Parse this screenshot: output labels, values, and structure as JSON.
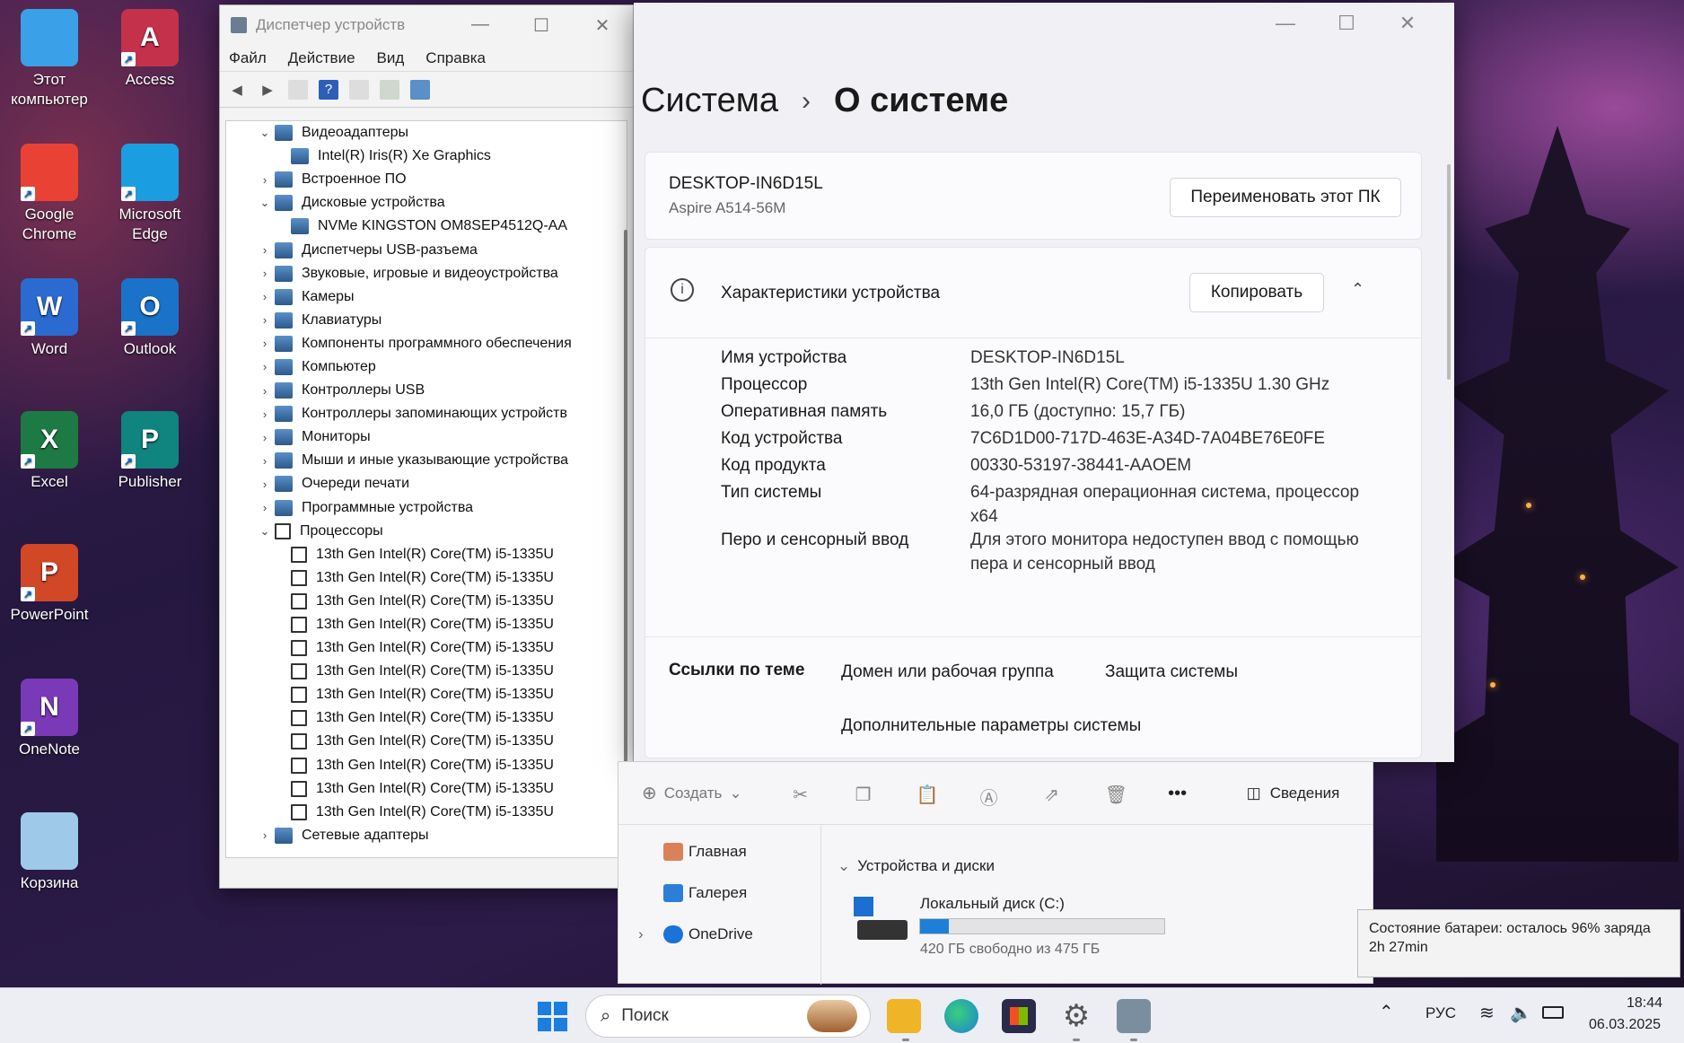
{
  "desktop": {
    "icons": [
      {
        "label": "Этот компьютер",
        "icon": "monitor-icon",
        "color": "#3aa0e8"
      },
      {
        "label": "Access",
        "icon": "access-icon",
        "color": "#c4314b",
        "letter": "A"
      },
      {
        "label": "Google Chrome",
        "icon": "chrome-icon",
        "color": "#e94235"
      },
      {
        "label": "Microsoft Edge",
        "icon": "edge-icon",
        "color": "#1b9de2"
      },
      {
        "label": "Word",
        "icon": "word-icon",
        "color": "#2b6bd1",
        "letter": "W"
      },
      {
        "label": "Outlook",
        "icon": "outlook-icon",
        "color": "#1a73c8",
        "letter": "O"
      },
      {
        "label": "Excel",
        "icon": "excel-icon",
        "color": "#1d7a45",
        "letter": "X"
      },
      {
        "label": "Publisher",
        "icon": "publisher-icon",
        "color": "#10847e",
        "letter": "P"
      },
      {
        "label": "PowerPoint",
        "icon": "powerpoint-icon",
        "color": "#d24726",
        "letter": "P"
      },
      {
        "label": "OneNote",
        "icon": "onenote-icon",
        "color": "#7a3ab8",
        "letter": "N"
      },
      {
        "label": "Корзина",
        "icon": "recycle-bin-icon",
        "color": "#9fc9e8"
      }
    ]
  },
  "devmgr": {
    "title": "Диспетчер устройств",
    "menu": [
      "Файл",
      "Действие",
      "Вид",
      "Справка"
    ],
    "tree": [
      {
        "label": "Видеоадаптеры",
        "level": 0,
        "exp": "v",
        "type": "cat"
      },
      {
        "label": "Intel(R) Iris(R) Xe Graphics",
        "level": 1,
        "exp": "",
        "type": "cat"
      },
      {
        "label": "Встроенное ПО",
        "level": 0,
        "exp": ">",
        "type": "cat"
      },
      {
        "label": "Дисковые устройства",
        "level": 0,
        "exp": "v",
        "type": "cat"
      },
      {
        "label": "NVMe KINGSTON OM8SEP4512Q-AA",
        "level": 1,
        "exp": "",
        "type": "cat"
      },
      {
        "label": "Диспетчеры USB-разъема",
        "level": 0,
        "exp": ">",
        "type": "cat"
      },
      {
        "label": "Звуковые, игровые и видеоустройства",
        "level": 0,
        "exp": ">",
        "type": "cat"
      },
      {
        "label": "Камеры",
        "level": 0,
        "exp": ">",
        "type": "cat"
      },
      {
        "label": "Клавиатуры",
        "level": 0,
        "exp": ">",
        "type": "cat"
      },
      {
        "label": "Компоненты программного обеспечения",
        "level": 0,
        "exp": ">",
        "type": "cat"
      },
      {
        "label": "Компьютер",
        "level": 0,
        "exp": ">",
        "type": "cat"
      },
      {
        "label": "Контроллеры USB",
        "level": 0,
        "exp": ">",
        "type": "cat"
      },
      {
        "label": "Контроллеры запоминающих устройств",
        "level": 0,
        "exp": ">",
        "type": "cat"
      },
      {
        "label": "Мониторы",
        "level": 0,
        "exp": ">",
        "type": "cat"
      },
      {
        "label": "Мыши и иные указывающие устройства",
        "level": 0,
        "exp": ">",
        "type": "cat"
      },
      {
        "label": "Очереди печати",
        "level": 0,
        "exp": ">",
        "type": "cat"
      },
      {
        "label": "Программные устройства",
        "level": 0,
        "exp": ">",
        "type": "cat"
      },
      {
        "label": "Процессоры",
        "level": 0,
        "exp": "v",
        "type": "chip"
      },
      {
        "label": "13th Gen Intel(R) Core(TM) i5-1335U",
        "level": 1,
        "exp": "",
        "type": "chip"
      },
      {
        "label": "13th Gen Intel(R) Core(TM) i5-1335U",
        "level": 1,
        "exp": "",
        "type": "chip"
      },
      {
        "label": "13th Gen Intel(R) Core(TM) i5-1335U",
        "level": 1,
        "exp": "",
        "type": "chip"
      },
      {
        "label": "13th Gen Intel(R) Core(TM) i5-1335U",
        "level": 1,
        "exp": "",
        "type": "chip"
      },
      {
        "label": "13th Gen Intel(R) Core(TM) i5-1335U",
        "level": 1,
        "exp": "",
        "type": "chip"
      },
      {
        "label": "13th Gen Intel(R) Core(TM) i5-1335U",
        "level": 1,
        "exp": "",
        "type": "chip"
      },
      {
        "label": "13th Gen Intel(R) Core(TM) i5-1335U",
        "level": 1,
        "exp": "",
        "type": "chip"
      },
      {
        "label": "13th Gen Intel(R) Core(TM) i5-1335U",
        "level": 1,
        "exp": "",
        "type": "chip"
      },
      {
        "label": "13th Gen Intel(R) Core(TM) i5-1335U",
        "level": 1,
        "exp": "",
        "type": "chip"
      },
      {
        "label": "13th Gen Intel(R) Core(TM) i5-1335U",
        "level": 1,
        "exp": "",
        "type": "chip"
      },
      {
        "label": "13th Gen Intel(R) Core(TM) i5-1335U",
        "level": 1,
        "exp": "",
        "type": "chip"
      },
      {
        "label": "13th Gen Intel(R) Core(TM) i5-1335U",
        "level": 1,
        "exp": "",
        "type": "chip"
      },
      {
        "label": "Сетевые адаптеры",
        "level": 0,
        "exp": ">",
        "type": "cat"
      }
    ]
  },
  "settings": {
    "crumb_parent": "Система",
    "crumb_current": "О системе",
    "pc_name": "DESKTOP-IN6D15L",
    "pc_model": "Aspire A514-56M",
    "rename_button": "Переименовать этот ПК",
    "specs_title": "Характеристики устройства",
    "copy_button": "Копировать",
    "specs": [
      {
        "k": "Имя устройства",
        "v": "DESKTOP-IN6D15L"
      },
      {
        "k": "Процессор",
        "v": "13th Gen Intel(R) Core(TM) i5-1335U   1.30 GHz"
      },
      {
        "k": "Оперативная память",
        "v": "16,0 ГБ (доступно: 15,7 ГБ)"
      },
      {
        "k": "Код устройства",
        "v": "7C6D1D00-717D-463E-A34D-7A04BE76E0FE"
      },
      {
        "k": "Код продукта",
        "v": "00330-53197-38441-AAOEM"
      },
      {
        "k": "Тип системы",
        "v": "64-разрядная операционная система, процессор x64"
      },
      {
        "k": "Перо и сенсорный ввод",
        "v": "Для этого монитора недоступен ввод с помощью пера и сенсорный ввод"
      }
    ],
    "links_label": "Ссылки по теме",
    "links": [
      "Домен или рабочая группа",
      "Защита системы",
      "Дополнительные параметры системы"
    ]
  },
  "explorer": {
    "create": "Создать",
    "details": "Сведения",
    "nav": [
      "Главная",
      "Галерея",
      "OneDrive"
    ],
    "section": "Устройства и диски",
    "disk_name": "Локальный диск (C:)",
    "disk_free": "420 ГБ свободно из 475 ГБ",
    "disk_used_fraction": 0.116
  },
  "tooltip": "Состояние батареи: осталось 96% заряда 2h 27min",
  "taskbar": {
    "search_placeholder": "Поиск",
    "lang": "РУС",
    "time": "18:44",
    "date": "06.03.2025"
  }
}
